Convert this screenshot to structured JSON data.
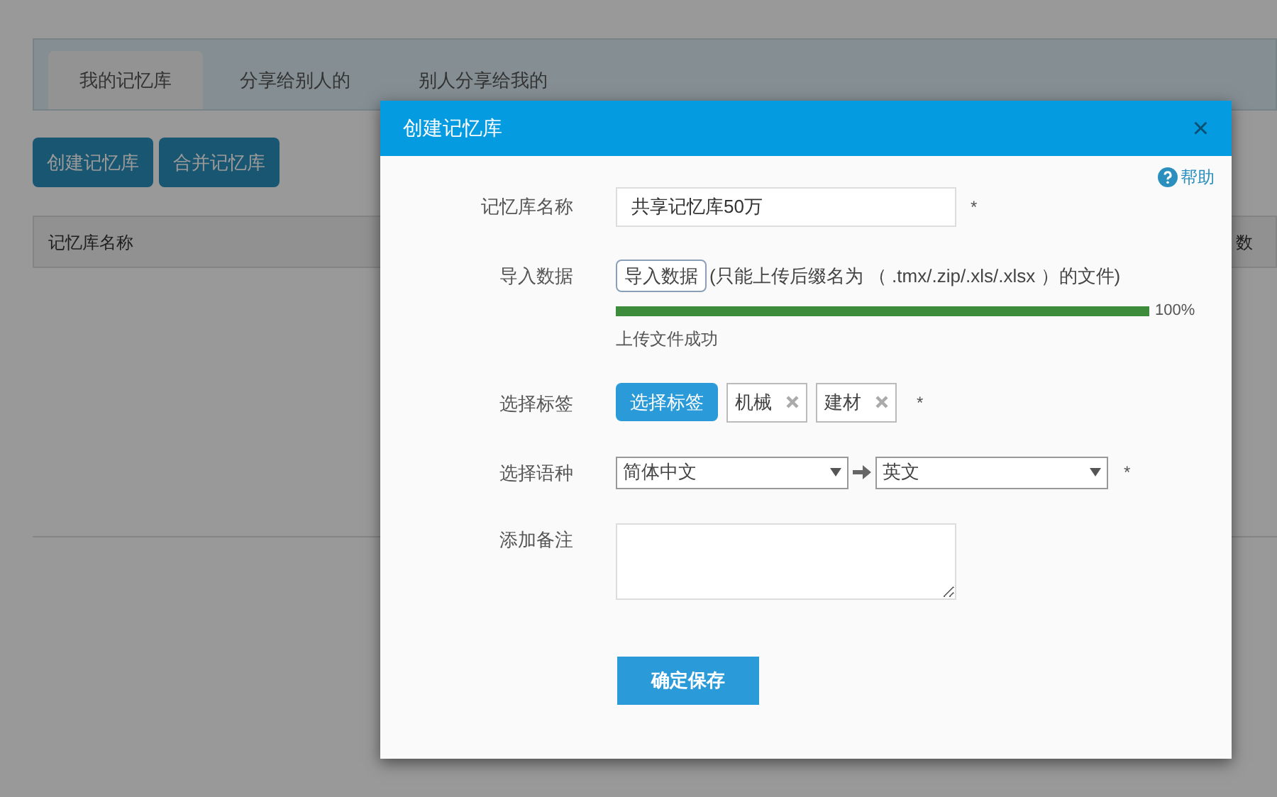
{
  "tabs": [
    {
      "label": "我的记忆库",
      "selected": true
    },
    {
      "label": "分享给别人的",
      "selected": false
    },
    {
      "label": "别人分享给我的",
      "selected": false
    }
  ],
  "actions": [
    "创建记忆库",
    "合并记忆库"
  ],
  "table": {
    "columns": [
      "记忆库名称",
      "数"
    ]
  },
  "dialog": {
    "title": "创建记忆库",
    "close": "×",
    "help": "帮助",
    "name": {
      "label": "记忆库名称",
      "value": "共享记忆库50万",
      "required": "*"
    },
    "import": {
      "label": "导入数据",
      "button": "导入数据",
      "hint": "(只能上传后缀名为 （ .tmx/.zip/.xls/.xlsx ）的文件)",
      "level": 1.0,
      "reading": "100%",
      "status": "上传文件成功"
    },
    "tags": {
      "label": "选择标签",
      "button": "选择标签",
      "items": [
        "机械",
        "建材"
      ],
      "required": "*"
    },
    "language": {
      "label": "选择语种",
      "source": "简体中文",
      "target": "英文",
      "required": "*"
    },
    "note": {
      "label": "添加备注"
    },
    "save": "确定保存"
  }
}
